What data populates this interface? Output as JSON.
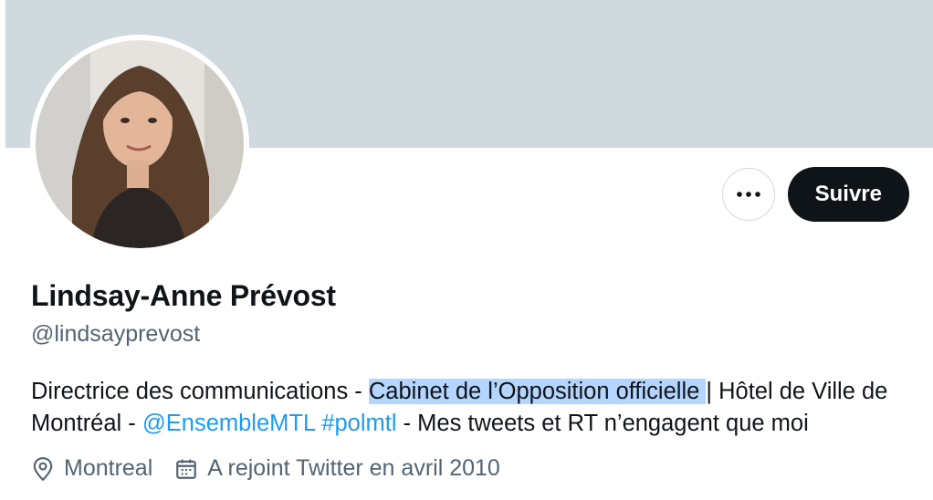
{
  "profile": {
    "name": "Lindsay-Anne Prévost",
    "handle": "@lindsayprevost",
    "bio": {
      "part1": "Directrice des communications - ",
      "highlighted": "Cabinet de l’Opposition officielle ",
      "part2": "| Hôtel de Ville de Montréal - ",
      "mention": "@EnsembleMTL",
      "space": " ",
      "hashtag": "#polmtl",
      "part3": " - Mes tweets et RT n’engagent que moi"
    },
    "location": "Montreal",
    "joined": "A rejoint Twitter en avril 2010"
  },
  "actions": {
    "more_icon": "more-horizontal-icon",
    "follow_label": "Suivre"
  },
  "icons": {
    "location": "location-pin-icon",
    "calendar": "calendar-icon"
  },
  "colors": {
    "banner": "#cfd9de",
    "accent": "#1d9bf0",
    "secondary_text": "#536471",
    "primary_text": "#0f1419",
    "selection": "#b4d5fe"
  }
}
